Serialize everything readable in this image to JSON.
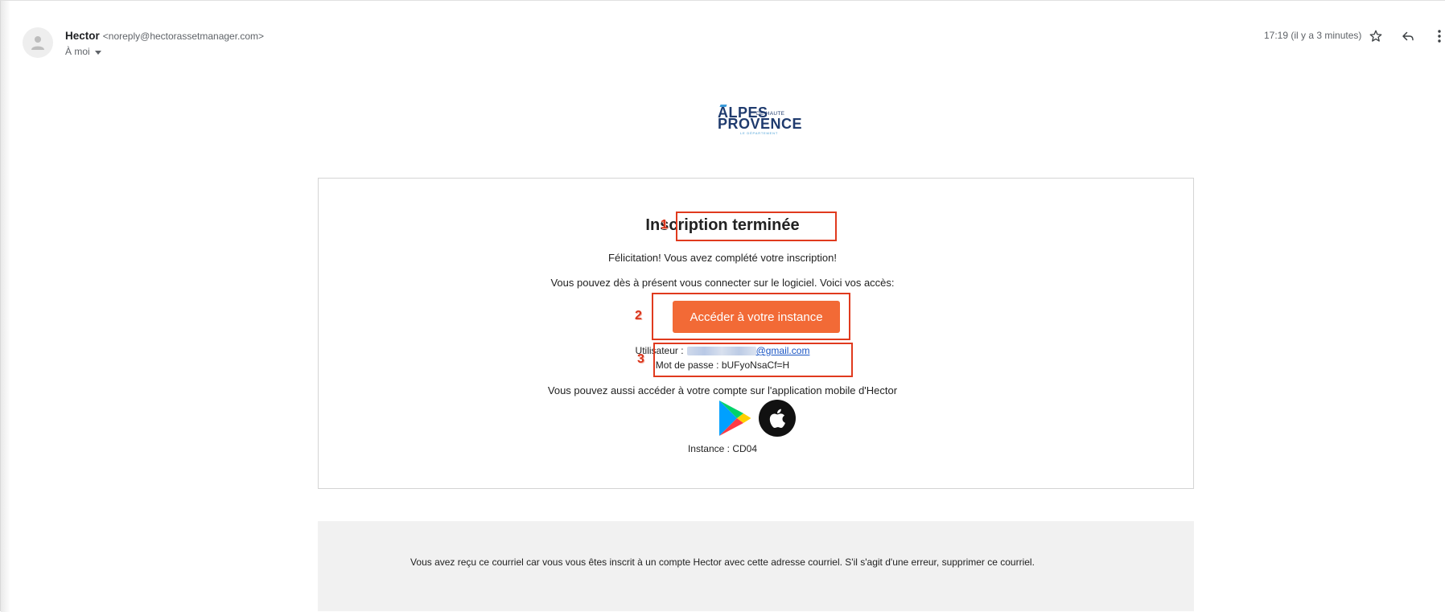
{
  "header": {
    "sender_name": "Hector",
    "sender_email": "<noreply@hectorassetmanager.com>",
    "recipient": "À moi",
    "timestamp": "17:19 (il y a 3 minutes)"
  },
  "logo": {
    "line1": "ALPES",
    "line1_small": "DE HAUTE",
    "line2": "PROVENCE",
    "line3": "LE DÉPARTEMENT"
  },
  "email": {
    "title": "Inscription terminée",
    "congrats": "Félicitation! Vous avez complété votre inscription!",
    "access_intro": "Vous pouvez dès à présent vous connecter sur le logiciel. Voici vos accès:",
    "cta_label": "Accéder à votre instance",
    "user_label": "Utilisateur :",
    "user_email_domain": "@gmail.com",
    "password_line": "Mot de passe : bUFyoNsaCf=H",
    "mobile_text": "Vous pouvez aussi accéder à votre compte sur l'application mobile d'Hector",
    "instance_line": "Instance : CD04"
  },
  "annotations": [
    "1",
    "2",
    "3"
  ],
  "footer": {
    "text": "Vous avez reçu ce courriel car vous vous êtes inscrit à un compte Hector avec cette adresse courriel. S'il s'agit d'une erreur, supprimer ce courriel."
  },
  "icons": [
    "avatar-icon",
    "star-icon",
    "reply-icon",
    "more-icon",
    "google-play-icon",
    "apple-icon"
  ],
  "colors": {
    "cta": "#f26a36",
    "annotation": "#e03a1e",
    "link": "#1a55c4",
    "logo": "#1f3b6e"
  }
}
